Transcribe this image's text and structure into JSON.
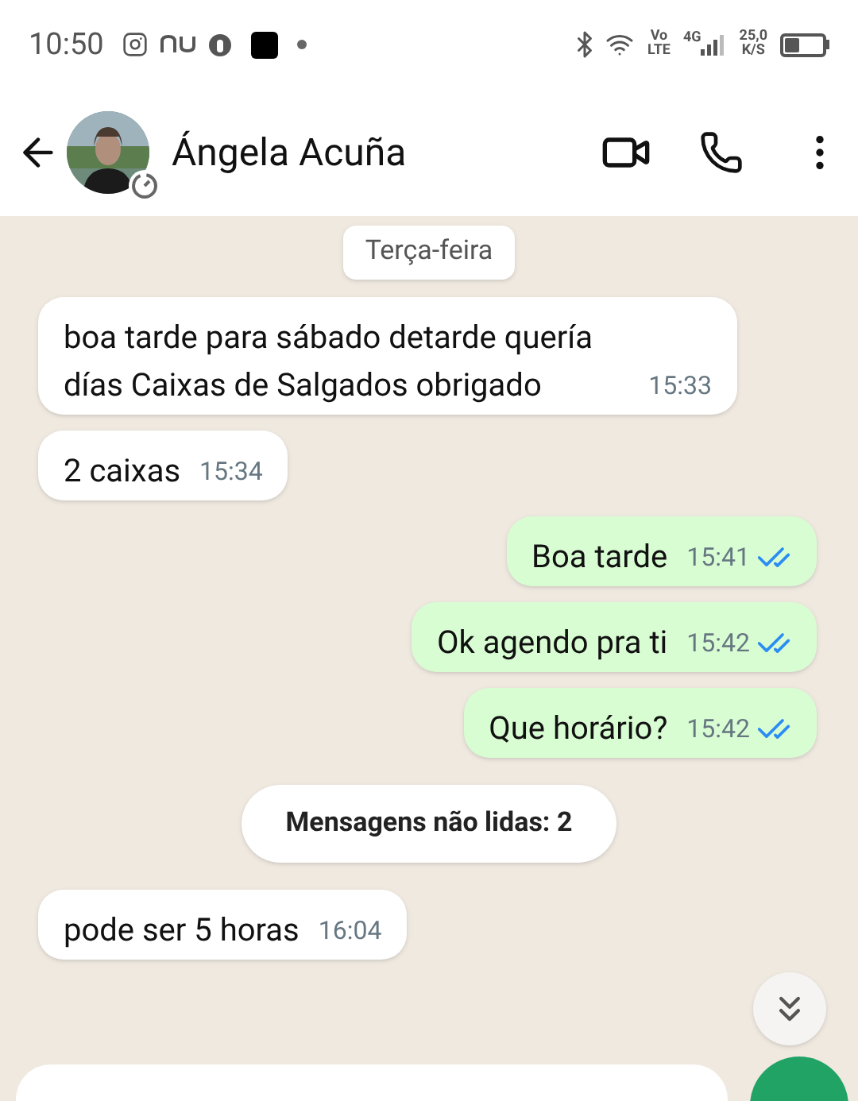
{
  "status_bar": {
    "time": "10:50",
    "volte_top": "Vo",
    "volte_bottom": "LTE",
    "network": "4G",
    "speed_value": "25,0",
    "speed_unit": "K/S"
  },
  "header": {
    "contact_name": "Ángela Acuña"
  },
  "date_chip": "Terça-feira",
  "messages": [
    {
      "kind": "incoming",
      "text": "boa tarde para sábado detarde quería días Caixas de Salgados obrigado",
      "time": "15:33"
    },
    {
      "kind": "incoming",
      "text": "2 caixas",
      "time": "15:34"
    },
    {
      "kind": "outgoing",
      "text": "Boa tarde",
      "time": "15:41",
      "read": true
    },
    {
      "kind": "outgoing",
      "text": "Ok agendo pra ti",
      "time": "15:42",
      "read": true
    },
    {
      "kind": "outgoing",
      "text": "Que horário?",
      "time": "15:42",
      "read": true
    },
    {
      "kind": "unread",
      "text": "Mensagens não lidas: 2"
    },
    {
      "kind": "incoming",
      "text": "pode ser 5 horas",
      "time": "16:04"
    }
  ]
}
